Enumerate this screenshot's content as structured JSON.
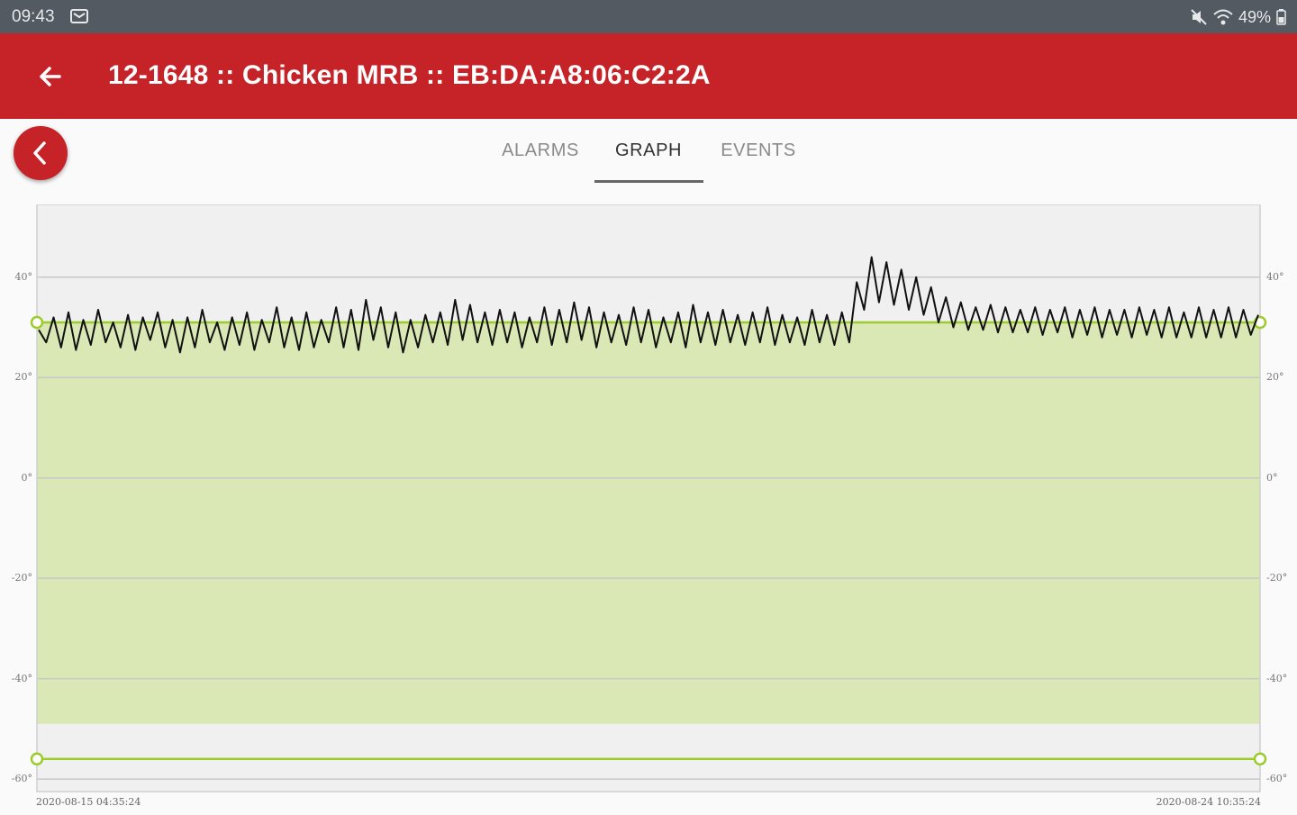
{
  "status_bar": {
    "time": "09:43",
    "battery": "49%",
    "icons": [
      "message-icon",
      "mute-icon",
      "wifi-icon",
      "battery-icon"
    ]
  },
  "app_bar": {
    "title": "12-1648 :: Chicken MRB :: EB:DA:A8:06:C2:2A",
    "back_icon": "arrow-left-icon",
    "color": "#c62328"
  },
  "tabs": [
    {
      "label": "ALARMS",
      "active": false
    },
    {
      "label": "GRAPH",
      "active": true
    },
    {
      "label": "EVENTS",
      "active": false
    }
  ],
  "chart_data": {
    "type": "line",
    "y_ticks": [
      "40°",
      "20°",
      "0°",
      "-20°",
      "-40°",
      "-60°"
    ],
    "y_tick_values": [
      40,
      20,
      0,
      -20,
      -40,
      -60
    ],
    "ylim": [
      -62.5,
      54.5
    ],
    "x_start_label": "2020-08-15 04:35:24",
    "x_end_label": "2020-08-24 10:35:24",
    "high_threshold": 31,
    "low_threshold": -56,
    "acceptable_band": [
      -49,
      31
    ],
    "band_color": "#d9e8b4",
    "threshold_color": "#9ccc2c",
    "line_color": "#111111",
    "series": [
      {
        "values": [
          29.5,
          27.0,
          32.0,
          26.0,
          33.0,
          25.5,
          31.5,
          26.5,
          33.5,
          27.0,
          31.0,
          26.0,
          32.5,
          25.5,
          32.0,
          27.5,
          33.0,
          26.0,
          31.5,
          25.0,
          32.0,
          26.0,
          33.5,
          27.0,
          31.0,
          25.5,
          32.0,
          26.5,
          33.0,
          25.5,
          31.5,
          27.0,
          34.0,
          26.0,
          32.0,
          25.5,
          33.0,
          26.0,
          31.5,
          27.0,
          34.0,
          26.0,
          33.5,
          25.5,
          35.5,
          27.5,
          34.0,
          26.0,
          33.0,
          25.0,
          31.5,
          26.0,
          32.5,
          27.0,
          33.0,
          26.5,
          35.5,
          27.5,
          34.5,
          27.0,
          33.0,
          26.5,
          33.5,
          27.0,
          33.0,
          26.0,
          32.0,
          27.0,
          34.0,
          26.5,
          33.5,
          27.0,
          35.0,
          27.5,
          34.0,
          26.0,
          33.0,
          27.0,
          32.5,
          26.5,
          34.0,
          27.0,
          33.5,
          26.0,
          32.0,
          27.0,
          33.0,
          26.0,
          34.5,
          27.0,
          33.0,
          26.5,
          33.5,
          27.0,
          32.5,
          26.5,
          33.0,
          27.0,
          34.0,
          26.5,
          32.5,
          27.0,
          32.0,
          26.5,
          33.5,
          27.0,
          32.5,
          26.5,
          33.0,
          27.0,
          39.0,
          33.5,
          44.0,
          35.0,
          43.0,
          34.5,
          41.5,
          33.5,
          40.0,
          32.5,
          38.0,
          31.0,
          36.0,
          30.0,
          35.0,
          29.5,
          34.0,
          29.5,
          34.5,
          29.0,
          34.0,
          29.0,
          33.5,
          29.0,
          34.0,
          28.5,
          33.5,
          29.0,
          34.0,
          28.0,
          33.5,
          28.5,
          34.0,
          28.0,
          33.5,
          28.5,
          33.5,
          28.0,
          34.0,
          28.5,
          33.5,
          28.0,
          34.0,
          28.0,
          33.0,
          28.0,
          34.0,
          28.0,
          33.5,
          28.0,
          34.0,
          28.0,
          33.5,
          28.5,
          32.5
        ]
      }
    ]
  }
}
